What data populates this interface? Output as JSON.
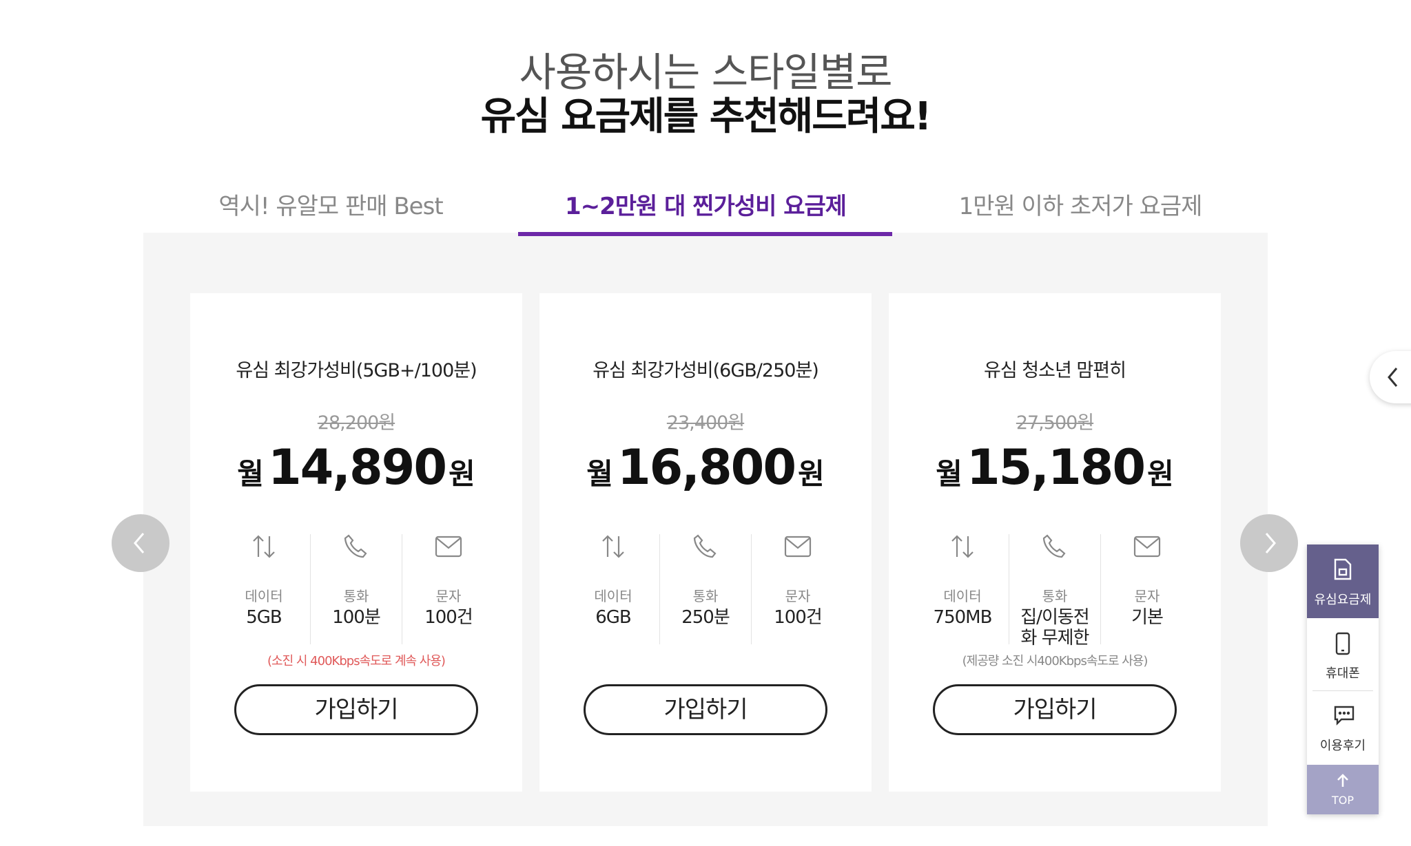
{
  "headline": {
    "sub": "사용하시는 스타일별로",
    "main": "유심 요금제를 추천해드려요!"
  },
  "tabs": [
    {
      "label": "역시! 유알모 판매 Best",
      "active": false
    },
    {
      "label": "1~2만원 대 찐가성비 요금제",
      "active": true
    },
    {
      "label": "1만원 이하 초저가 요금제",
      "active": false
    }
  ],
  "accent_color": "#6d28a8",
  "plans": [
    {
      "name": "유심 최강가성비(5GB+/100분)",
      "original_price": "28,200원",
      "price_prefix": "월",
      "price": "14,890",
      "price_suffix": "원",
      "data_label": "데이터",
      "data_value": "5GB",
      "call_label": "통화",
      "call_value": "100분",
      "sms_label": "문자",
      "sms_value": "100건",
      "note": "(소진 시 400Kbps속도로 계속 사용)",
      "join": "가입하기"
    },
    {
      "name": "유심 최강가성비(6GB/250분)",
      "original_price": "23,400원",
      "price_prefix": "월",
      "price": "16,800",
      "price_suffix": "원",
      "data_label": "데이터",
      "data_value": "6GB",
      "call_label": "통화",
      "call_value": "250분",
      "sms_label": "문자",
      "sms_value": "100건",
      "note": "",
      "join": "가입하기"
    },
    {
      "name": "유심 청소년 맘편히",
      "original_price": "27,500원",
      "price_prefix": "월",
      "price": "15,180",
      "price_suffix": "원",
      "data_label": "데이터",
      "data_value": "750MB",
      "call_label": "통화",
      "call_value": "집/이동전화 무제한",
      "sms_label": "문자",
      "sms_value": "기본",
      "note": "(제공량 소진 시400Kbps속도로 사용)",
      "join": "가입하기"
    }
  ],
  "quick_menu": {
    "usim": "유심요금제",
    "phone": "휴대폰",
    "review": "이용후기",
    "top": "TOP"
  },
  "icons": {
    "data": "arrows-up-down-icon",
    "call": "phone-icon",
    "sms": "envelope-icon",
    "prev": "chevron-left-icon",
    "next": "chevron-right-icon"
  }
}
